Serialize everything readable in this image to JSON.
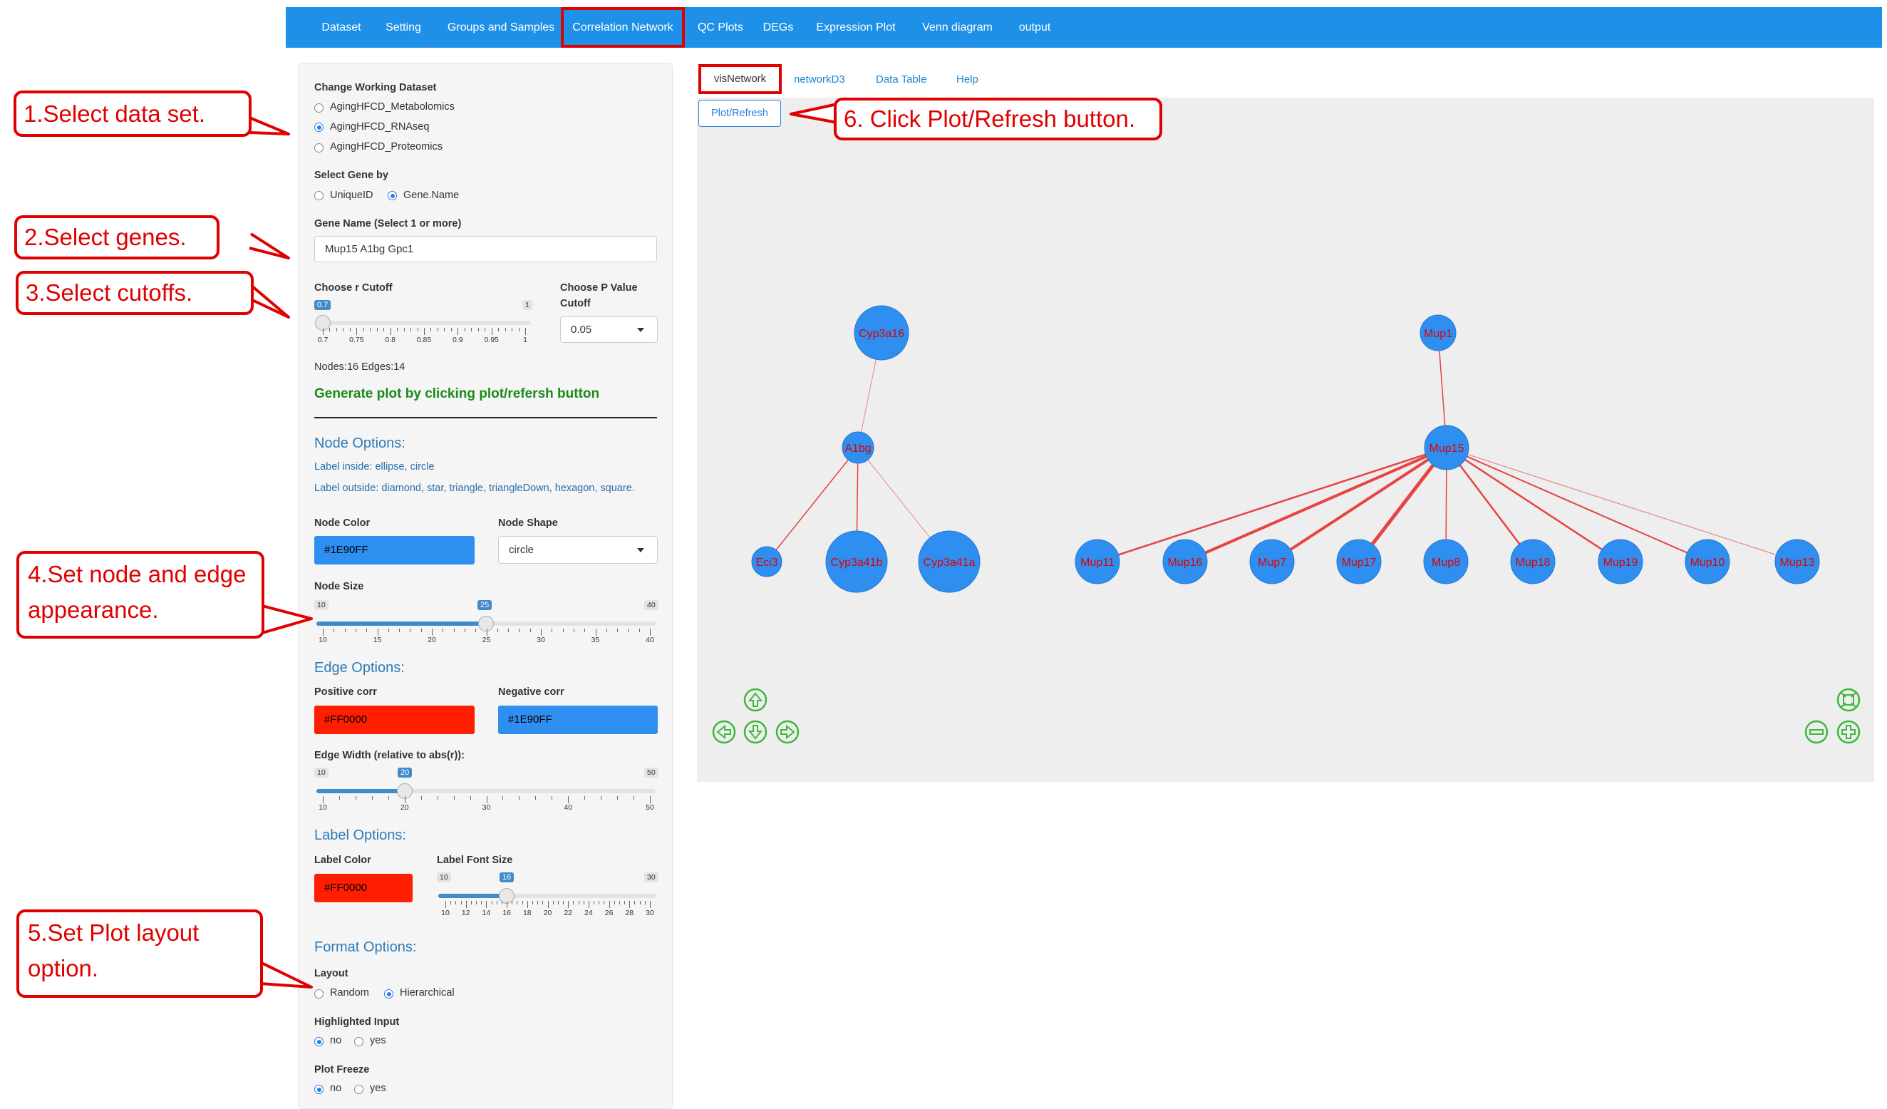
{
  "nav": {
    "items": [
      "Dataset",
      "Setting",
      "Groups and Samples",
      "Correlation Network",
      "QC Plots",
      "DEGs",
      "Expression Plot",
      "Venn diagram",
      "output"
    ],
    "active": "Correlation Network"
  },
  "sidebar": {
    "dataset_label": "Change Working Dataset",
    "datasets": [
      "AgingHFCD_Metabolomics",
      "AgingHFCD_RNAseq",
      "AgingHFCD_Proteomics"
    ],
    "dataset_selected": "AgingHFCD_RNAseq",
    "select_gene_label": "Select Gene by",
    "gene_by_options": [
      "UniqueID",
      "Gene.Name"
    ],
    "gene_by_selected": "Gene.Name",
    "gene_name_label": "Gene Name (Select 1 or more)",
    "gene_name_value": "Mup15  A1bg  Gpc1",
    "r_cutoff_label": "Choose r Cutoff",
    "r_cutoff": {
      "value": "0.7",
      "min": "0.7",
      "max": "1",
      "ticks": [
        "0.7",
        "0.75",
        "0.8",
        "0.85",
        "0.9",
        "0.95",
        "1"
      ]
    },
    "p_cutoff_label_1": "Choose P Value",
    "p_cutoff_label_2": "Cutoff",
    "p_cutoff_value": "0.05",
    "nodes_edges": "Nodes:16 Edges:14",
    "generate_hint": "Generate plot by clicking plot/refersh button",
    "node_options_title": "Node Options:",
    "label_inside": "Label inside: ellipse, circle",
    "label_outside": "Label outside: diamond, star, triangle, triangleDown, hexagon, square.",
    "node_color_label": "Node Color",
    "node_color_value": "#1E90FF",
    "node_shape_label": "Node Shape",
    "node_shape_value": "circle",
    "node_size_label": "Node Size",
    "node_size": {
      "value": "25",
      "min": "10",
      "max": "40",
      "ticks": [
        "10",
        "15",
        "20",
        "25",
        "30",
        "35",
        "40"
      ]
    },
    "edge_options_title": "Edge Options:",
    "pos_corr_label": "Positive corr",
    "pos_corr_value": "#FF0000",
    "neg_corr_label": "Negative corr",
    "neg_corr_value": "#1E90FF",
    "edge_width_label": "Edge Width (relative to abs(r)):",
    "edge_width": {
      "value": "20",
      "min": "10",
      "max": "50",
      "ticks": [
        "10",
        "20",
        "30",
        "40",
        "50"
      ]
    },
    "label_options_title": "Label Options:",
    "label_color_label": "Label Color",
    "label_color_value": "#FF0000",
    "label_font_size_label": "Label Font Size",
    "label_font_size": {
      "value": "16",
      "min": "10",
      "max": "30",
      "ticks": [
        "10",
        "12",
        "14",
        "16",
        "18",
        "20",
        "22",
        "24",
        "26",
        "28",
        "30"
      ]
    },
    "format_options_title": "Format Options:",
    "layout_label": "Layout",
    "layout_options": [
      "Random",
      "Hierarchical"
    ],
    "layout_selected": "Hierarchical",
    "highlighted_label": "Highlighted Input",
    "highlighted_options": [
      "no",
      "yes"
    ],
    "highlighted_selected": "no",
    "freeze_label": "Plot Freeze",
    "freeze_options": [
      "no",
      "yes"
    ],
    "freeze_selected": "no"
  },
  "tabs": {
    "items": [
      "visNetwork",
      "networkD3",
      "Data Table",
      "Help"
    ],
    "active": "visNetwork"
  },
  "plot_button": "Plot/Refresh",
  "callouts": {
    "c1": "1.Select data set.",
    "c2": "2.Select genes.",
    "c3": "3.Select cutoffs.",
    "c4a": "4.Set node and edge",
    "c4b": "appearance.",
    "c5a": "5.Set Plot layout",
    "c5b": "option.",
    "c6": "6. Click Plot/Refresh button."
  },
  "network": {
    "node_color": "#2f8ff0",
    "label_color": "#e00000",
    "edge_color": "#e53030",
    "nodes": [
      "Cyp3a16",
      "A1bg",
      "Eci3",
      "Cyp3a41b",
      "Cyp3a41a",
      "Mup1",
      "Mup15",
      "Mup11",
      "Mup16",
      "Mup7",
      "Mup17",
      "Mup8",
      "Mup18",
      "Mup19",
      "Mup10",
      "Mup13"
    ]
  },
  "colors": {
    "nav_bg": "#1e90e8",
    "accent_red": "#e00000",
    "positive": "#ff1f00",
    "negative": "#2f8ff0",
    "icon_green": "#3cb83c"
  }
}
